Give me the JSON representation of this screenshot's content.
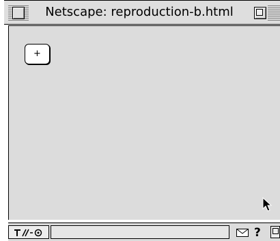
{
  "window": {
    "title": "Netscape: reproduction-b.html"
  },
  "content": {
    "add_button_label": "+"
  },
  "icons": {
    "close": "close-box-icon",
    "zoom": "zoom-box-icon",
    "security": "security-status-icon",
    "mail": "mail-icon",
    "help": "?",
    "grow": "grow-box-icon",
    "cursor": "arrow-cursor-icon"
  },
  "colors": {
    "content_background": "#dcdcdc",
    "titlebar_background": "#dedede"
  }
}
